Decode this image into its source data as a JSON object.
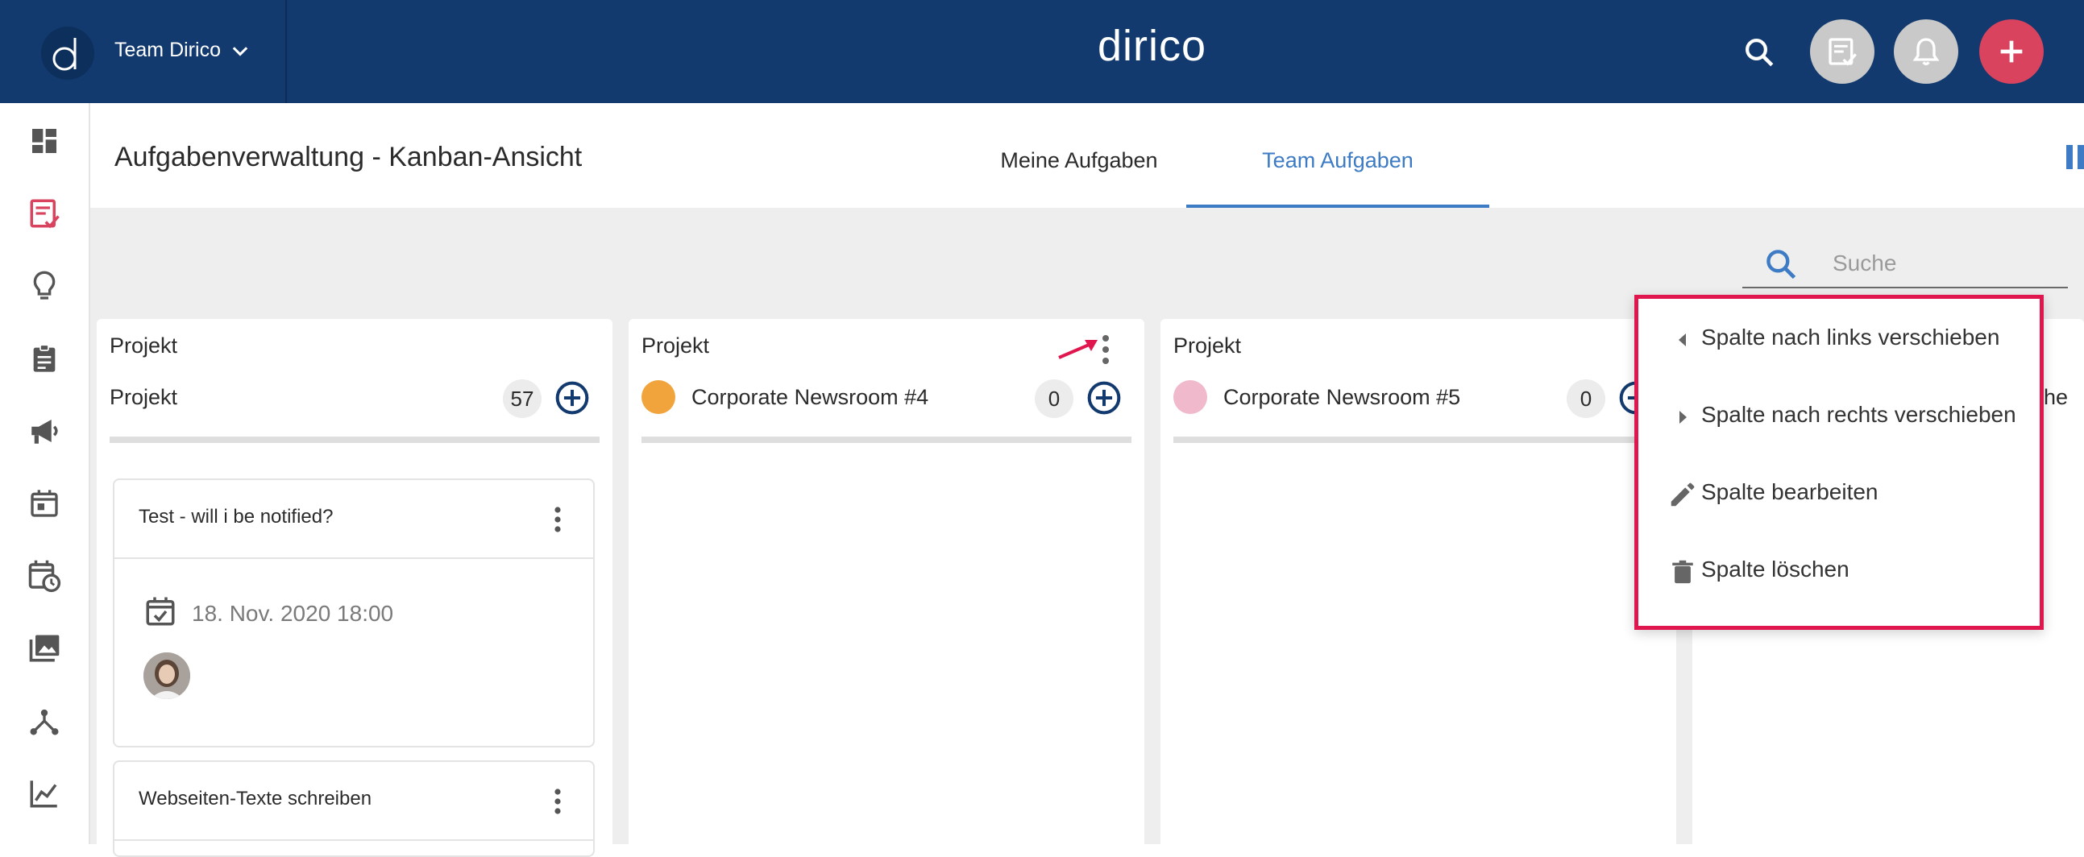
{
  "topbar": {
    "team_name": "Team Dirico",
    "brand": "dirico",
    "logo_letter": "d",
    "icons": [
      "search-icon",
      "task-check-icon",
      "bell-icon",
      "plus-icon"
    ],
    "colors": {
      "bar": "#123a6e",
      "add_button": "#d9435e",
      "round_button": "#c9c9c9"
    }
  },
  "sidebar": {
    "items": [
      {
        "icon": "dashboard-icon",
        "active": false
      },
      {
        "icon": "tasks-icon",
        "active": true
      },
      {
        "icon": "lightbulb-icon",
        "active": false
      },
      {
        "icon": "clipboard-icon",
        "active": false
      },
      {
        "icon": "megaphone-icon",
        "active": false
      },
      {
        "icon": "calendar-icon",
        "active": false
      },
      {
        "icon": "calendar-clock-icon",
        "active": false
      },
      {
        "icon": "media-library-icon",
        "active": false
      },
      {
        "icon": "network-icon",
        "active": false
      },
      {
        "icon": "analytics-icon",
        "active": false
      }
    ],
    "active_color": "#d9435e"
  },
  "header": {
    "title": "Aufgabenverwaltung - Kanban-Ansicht",
    "tabs": [
      {
        "label": "Meine Aufgaben",
        "active": false
      },
      {
        "label": "Team Aufgaben",
        "active": true
      }
    ],
    "accent": "#3d7bc4"
  },
  "search": {
    "placeholder": "Suche",
    "value": ""
  },
  "columns": [
    {
      "type": "Projekt",
      "name": "Projekt",
      "count": "57",
      "dot_color": ""
    },
    {
      "type": "Projekt",
      "name": "Corporate Newsroom #4",
      "count": "0",
      "dot_color": "#f2a43c"
    },
    {
      "type": "Projekt",
      "name": "Corporate Newsroom #5",
      "count": "0",
      "dot_color": "#f0b9cc"
    },
    {
      "name_fragment": "he"
    }
  ],
  "cards": [
    {
      "title": "Test - will i be notified?",
      "date": "18. Nov. 2020 18:00"
    },
    {
      "title": "Webseiten-Texte schreiben"
    }
  ],
  "context_menu": {
    "items": [
      {
        "label": "Spalte nach links verschieben",
        "icon": "caret-left-icon"
      },
      {
        "label": "Spalte nach rechts verschieben",
        "icon": "caret-right-icon"
      },
      {
        "label": "Spalte bearbeiten",
        "icon": "pencil-icon"
      },
      {
        "label": "Spalte löschen",
        "icon": "trash-icon"
      }
    ],
    "highlight_color": "#e0174f"
  }
}
